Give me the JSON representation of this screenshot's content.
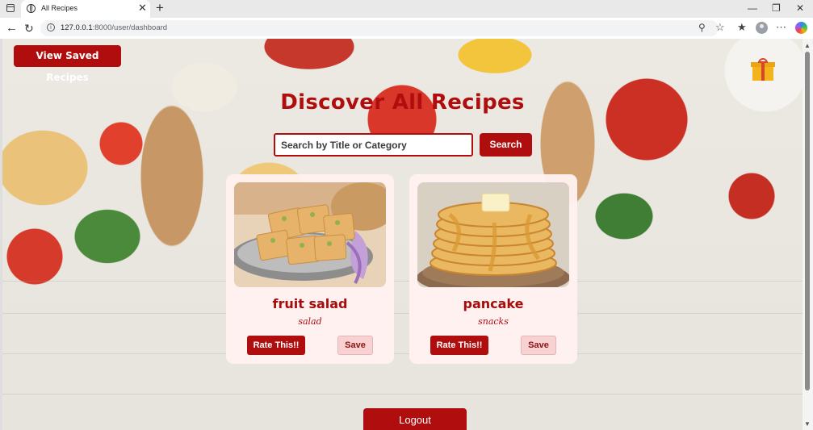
{
  "browser": {
    "tab_title": "All Recipes",
    "tab_close": "✕",
    "new_tab": "+",
    "url_host": "127.0.0.1",
    "url_path": ":8000/user/dashboard",
    "controls": {
      "minimize": "—",
      "maximize": "❐",
      "close": "✕"
    },
    "icons": [
      "back-icon",
      "reload-icon",
      "info-icon",
      "zoom-icon",
      "favorite-icon",
      "collections-icon",
      "profile-icon",
      "more-icon",
      "copilot-icon"
    ]
  },
  "header": {
    "saved_button": "View Saved Recipes",
    "title": "Discover All Recipes"
  },
  "search": {
    "placeholder": "Search by Title or Category",
    "button": "Search"
  },
  "recipes": [
    {
      "title": "fruit salad",
      "category": "salad",
      "rate_label": "Rate This!!",
      "save_label": "Save"
    },
    {
      "title": "pancake",
      "category": "snacks",
      "rate_label": "Rate This!!",
      "save_label": "Save"
    }
  ],
  "footer": {
    "logout": "Logout"
  },
  "colors": {
    "brand": "#b00e0e",
    "card_bg": "#fff1f0",
    "save_bg": "#f8d2d2"
  }
}
